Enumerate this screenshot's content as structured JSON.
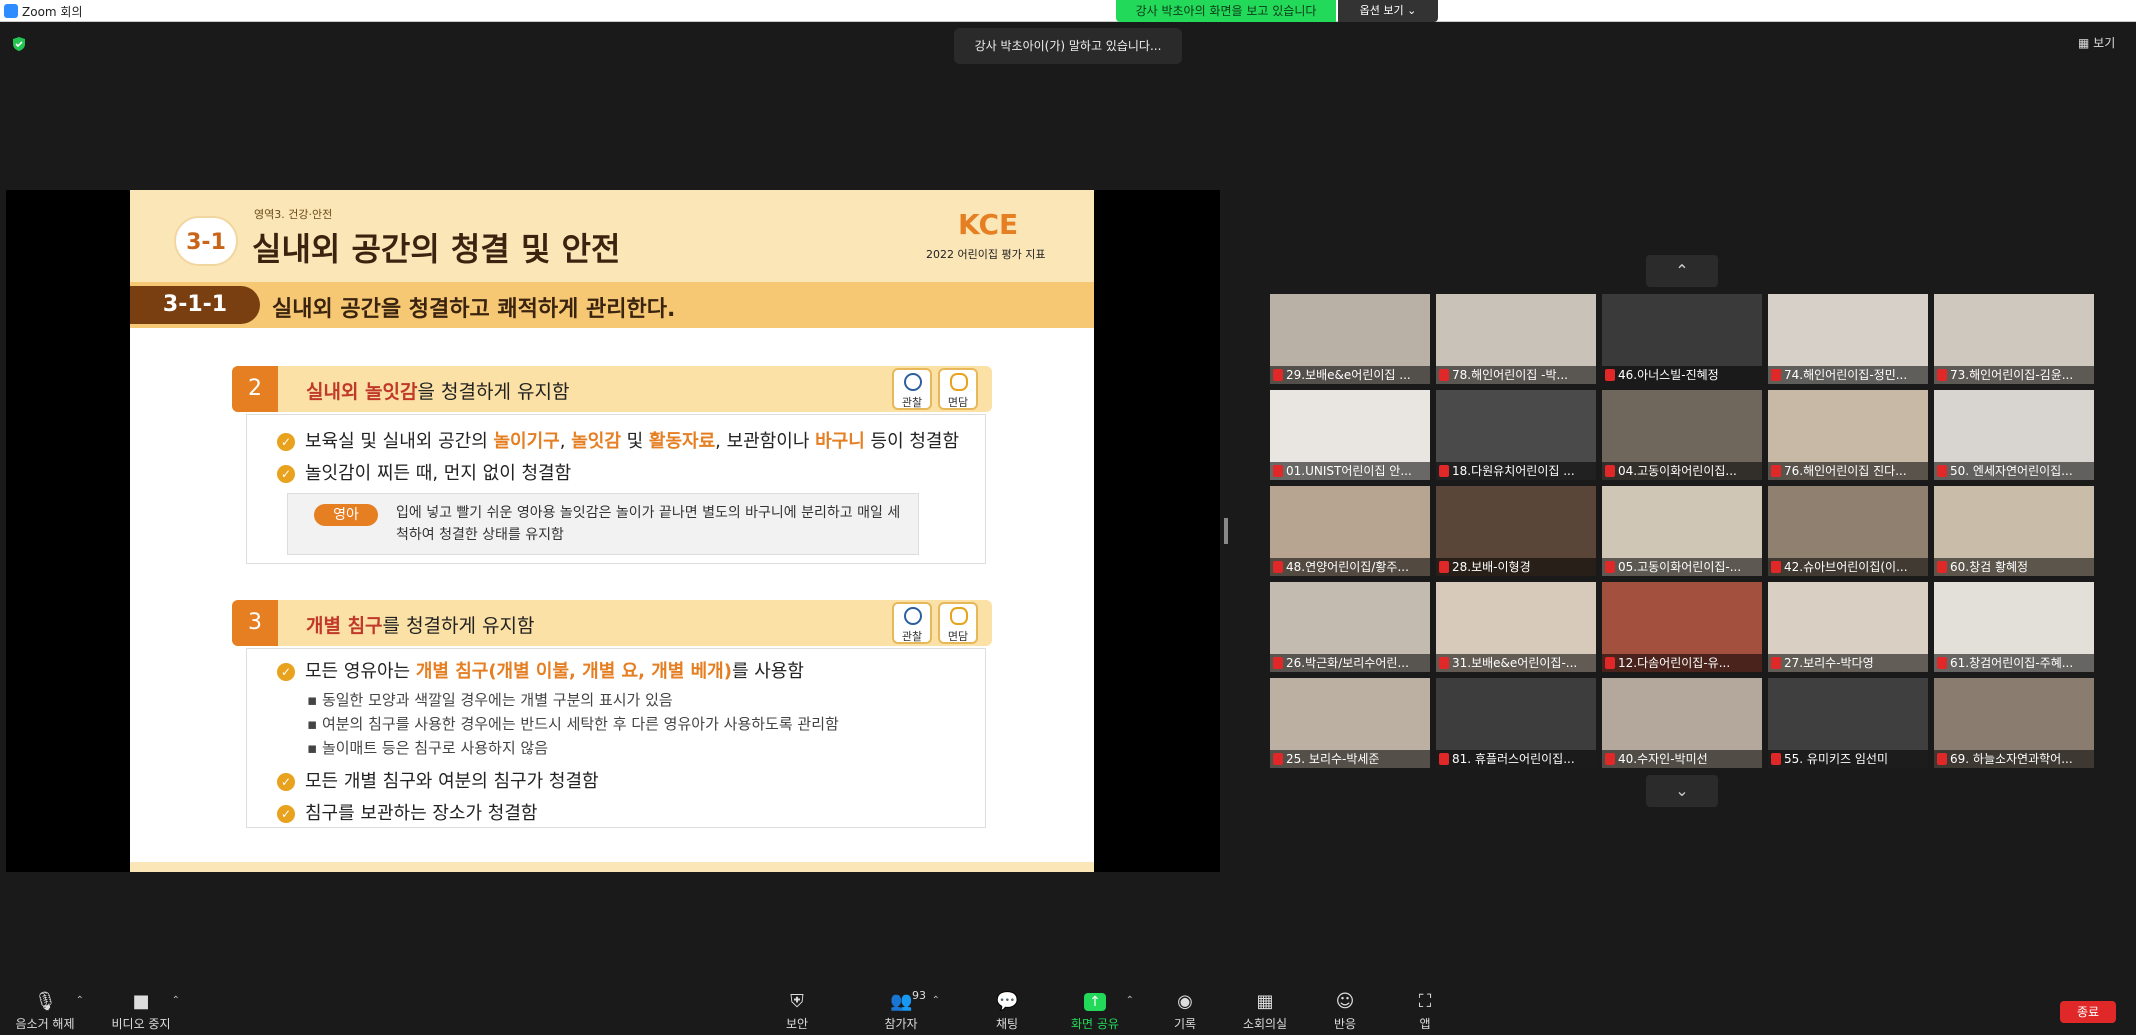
{
  "window": {
    "title": "Zoom 회의"
  },
  "banner": {
    "sharing": "강사 박초아의 화면을 보고 있습니다",
    "view_options": "옵션 보기 ⌄"
  },
  "speaker_toast": "강사 박초아이(가) 말하고 있습니다...",
  "view_button": "보기",
  "slide": {
    "domain": "영역3. 건강·안전",
    "number": "3-1",
    "title": "실내외 공간의 청결 및 안전",
    "logo": "KCE",
    "logo_sub": "2022 어린이집 평가 지표",
    "sub_tag": "3-1-1",
    "sub_text": "실내외 공간을 청결하고 쾌적하게 관리한다.",
    "item2": {
      "num": "2",
      "highlight": "실내외 놀잇감",
      "rest": "을 청결하게 유지함",
      "badge1": "관찰",
      "badge2": "면담",
      "b1_a": "보육실 및 실내외 공간의 ",
      "b1_o1": "놀이기구",
      "b1_c1": ", ",
      "b1_o2": "놀잇감",
      "b1_m": " 및 ",
      "b1_o3": "활동자료",
      "b1_n": ", 보관함이나 ",
      "b1_o4": "바구니",
      "b1_end": " 등이 청결함",
      "b2": "놀잇감이 찌든 때, 먼지 없이 청결함",
      "infant_tag": "영아",
      "infant_text": "입에 넣고 빨기 쉬운 영아용 놀잇감은 놀이가 끝나면 별도의 바구니에 분리하고 매일 세척하여 청결한 상태를 유지함"
    },
    "item3": {
      "num": "3",
      "highlight": "개별 침구",
      "rest": "를 청결하게 유지함",
      "badge1": "관찰",
      "badge2": "면담",
      "b1_a": "모든 영유아는 ",
      "b1_o": "개별 침구(개별 이불, 개별 요, 개별 베개)",
      "b1_end": "를 사용함",
      "s1": "동일한 모양과 색깔일 경우에는 개별 구분의 표시가 있음",
      "s2": "여분의 침구를 사용한 경우에는 반드시 세탁한 후 다른 영유아가 사용하도록 관리함",
      "s3": "놀이매트 등은 침구로 사용하지 않음",
      "b2": "모든 개별 침구와 여분의 침구가 청결함",
      "b3": "침구를 보관하는 장소가 청결함"
    }
  },
  "gallery": {
    "nav_up": "⌃",
    "nav_down": "⌄",
    "tiles": [
      {
        "name": "29.보배e&e어린이집 ...",
        "bg": "#b9b0a6"
      },
      {
        "name": "78.해인어린이집 -박...",
        "bg": "#c8c2b8"
      },
      {
        "name": "46.아너스빌-진혜정",
        "bg": "#3a3a3a"
      },
      {
        "name": "74.해인어린이집-정민...",
        "bg": "#d6d0c8"
      },
      {
        "name": "73.해인어린이집-김윤...",
        "bg": "#cfc8bf"
      },
      {
        "name": "01.UNIST어린이집 안...",
        "bg": "#e9e6e2"
      },
      {
        "name": "18.다원유치어린이집 ...",
        "bg": "#4a4a4a"
      },
      {
        "name": "04.고동이화어린이집...",
        "bg": "#6f665c"
      },
      {
        "name": "76.해인어린이집 진다...",
        "bg": "#c7b9a6"
      },
      {
        "name": "50. 엔세자연어린이집...",
        "bg": "#d8d4cf"
      },
      {
        "name": "48.연양어린이집/황주...",
        "bg": "#b7a591"
      },
      {
        "name": "28.보배-이형경",
        "bg": "#5a4638"
      },
      {
        "name": "05.고동이화어린이집-...",
        "bg": "#cfc6b6"
      },
      {
        "name": "42.슈아브어린이집(이...",
        "bg": "#8f8070"
      },
      {
        "name": "60.창검 황혜정",
        "bg": "#c9bda9"
      },
      {
        "name": "26.박근화/보리수어린...",
        "bg": "#c4bbb0"
      },
      {
        "name": "31.보배e&e어린이집-...",
        "bg": "#d8cabb"
      },
      {
        "name": "12.다솜어린이집-유...",
        "bg": "#a4503f"
      },
      {
        "name": "27.보리수-박다영",
        "bg": "#d9cfc2"
      },
      {
        "name": "61.창검어린이집-주혜...",
        "bg": "#e3e0da"
      },
      {
        "name": "25. 보리수-박세준",
        "bg": "#bcb0a2"
      },
      {
        "name": "81. 휴플러스어린이집...",
        "bg": "#3d3d3d"
      },
      {
        "name": "40.수자인-박미선",
        "bg": "#b4a89c"
      },
      {
        "name": "55. 유미키즈 임선미",
        "bg": "#3f3f3f"
      },
      {
        "name": "69. 하늘소자연과학어...",
        "bg": "#8a7d70"
      }
    ]
  },
  "toolbar": {
    "mute": "음소거 해제",
    "video": "비디오 중지",
    "security": "보안",
    "participants": "참가자",
    "participants_count": "93",
    "chat": "채팅",
    "share": "화면 공유",
    "record": "기록",
    "breakout": "소회의실",
    "reactions": "반응",
    "apps": "앱",
    "end": "종료"
  },
  "colors": {
    "share_green": "#23d959",
    "end_red": "#e02828",
    "accent_orange": "#e67e22"
  }
}
